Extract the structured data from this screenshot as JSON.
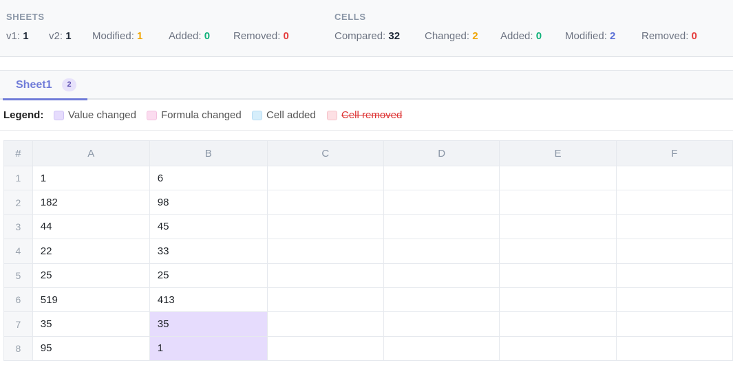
{
  "summary": {
    "sheets": {
      "title": "SHEETS",
      "stats": [
        {
          "label": "v1:",
          "value": "1",
          "color": "#1f2937"
        },
        {
          "label": "v2:",
          "value": "1",
          "color": "#1f2937"
        },
        {
          "label": "Modified:",
          "value": "1",
          "color": "#f0a500"
        },
        {
          "label": "Added:",
          "value": "0",
          "color": "#10b27a"
        },
        {
          "label": "Removed:",
          "value": "0",
          "color": "#e53e3e"
        }
      ]
    },
    "cells": {
      "title": "CELLS",
      "stats": [
        {
          "label": "Compared:",
          "value": "32",
          "color": "#1f2937"
        },
        {
          "label": "Changed:",
          "value": "2",
          "color": "#f0a500"
        },
        {
          "label": "Added:",
          "value": "0",
          "color": "#10b27a"
        },
        {
          "label": "Modified:",
          "value": "2",
          "color": "#5a6fd6"
        },
        {
          "label": "Removed:",
          "value": "0",
          "color": "#e53e3e"
        }
      ]
    }
  },
  "tab": {
    "label": "Sheet1",
    "badge": "2"
  },
  "legend": {
    "title": "Legend:",
    "items": [
      {
        "label": "Value changed",
        "color": "#e6dcfd",
        "border": "#cfc2f5"
      },
      {
        "label": "Formula changed",
        "color": "#fbdcef",
        "border": "#f3c1df"
      },
      {
        "label": "Cell added",
        "color": "#d6eefb",
        "border": "#b7dcf3"
      },
      {
        "label": "Cell removed",
        "color": "#fde0e4",
        "border": "#f5c2c9"
      }
    ]
  },
  "grid": {
    "corner": "#",
    "columns": [
      "A",
      "B",
      "C",
      "D",
      "E",
      "F"
    ],
    "rows": [
      {
        "num": "1",
        "A": "1",
        "B": "6"
      },
      {
        "num": "2",
        "A": "182",
        "B": "98"
      },
      {
        "num": "3",
        "A": "44",
        "B": "45"
      },
      {
        "num": "4",
        "A": "22",
        "B": "33"
      },
      {
        "num": "5",
        "A": "25",
        "B": "25"
      },
      {
        "num": "6",
        "A": "519",
        "B": "413"
      },
      {
        "num": "7",
        "A": "35",
        "B": "35"
      },
      {
        "num": "8",
        "A": "95",
        "B": "1"
      }
    ]
  }
}
